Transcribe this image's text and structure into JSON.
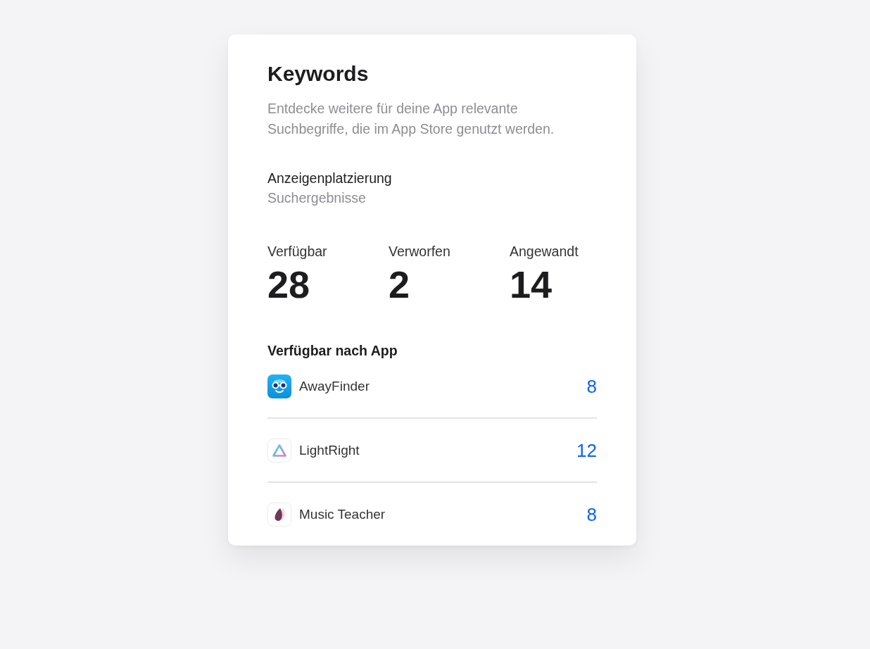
{
  "card": {
    "title": "Keywords",
    "description": "Entdecke weitere für deine App relevante Suchbegriffe, die im App Store genutzt werden.",
    "placement": {
      "label": "Anzeigenplatzierung",
      "value": "Suchergebnisse"
    },
    "stats": [
      {
        "label": "Verfügbar",
        "value": "28"
      },
      {
        "label": "Verworfen",
        "value": "2"
      },
      {
        "label": "Angewandt",
        "value": "14"
      }
    ],
    "by_app": {
      "heading": "Verfügbar nach App",
      "apps": [
        {
          "name": "AwayFinder",
          "count": "8"
        },
        {
          "name": "LightRight",
          "count": "12"
        },
        {
          "name": "Music Teacher",
          "count": "8"
        }
      ]
    }
  }
}
